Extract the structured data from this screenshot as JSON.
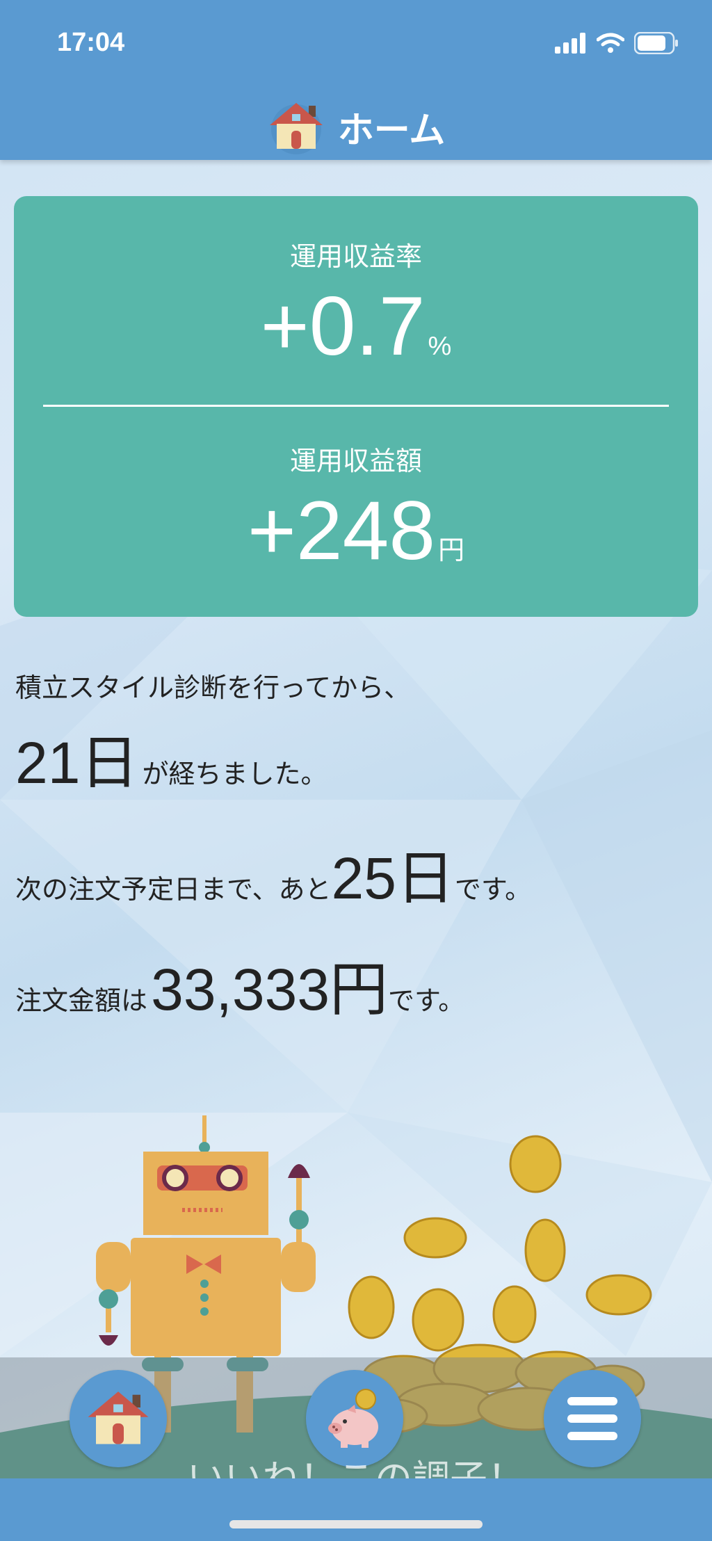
{
  "status_bar": {
    "time": "17:04"
  },
  "header": {
    "title": "ホーム",
    "icon": "house-icon"
  },
  "summary": {
    "rate_label": "運用収益率",
    "rate_value": "+0.7",
    "rate_unit": "%",
    "amount_label": "運用収益額",
    "amount_value": "+248",
    "amount_unit": "円"
  },
  "info": {
    "line1": "積立スタイル診断を行ってから、",
    "days_elapsed": "21日",
    "line2_suffix": "が経ちました。",
    "next_order_prefix": "次の注文予定日まで、あと",
    "next_order_days": "25日",
    "next_order_suffix": "です。",
    "order_amount_prefix": "注文金額は",
    "order_amount": "33,333円",
    "order_amount_suffix": "です。"
  },
  "footer": {
    "caption": "いいね！この調子！"
  },
  "nav": [
    {
      "name": "home",
      "icon": "house-icon"
    },
    {
      "name": "savings",
      "icon": "piggy-bank-icon"
    },
    {
      "name": "menu",
      "icon": "menu-icon"
    }
  ],
  "colors": {
    "header": "#5a9ad1",
    "card": "#58b7aa",
    "robot": "#e8b25a",
    "coin": "#e0b83a"
  }
}
